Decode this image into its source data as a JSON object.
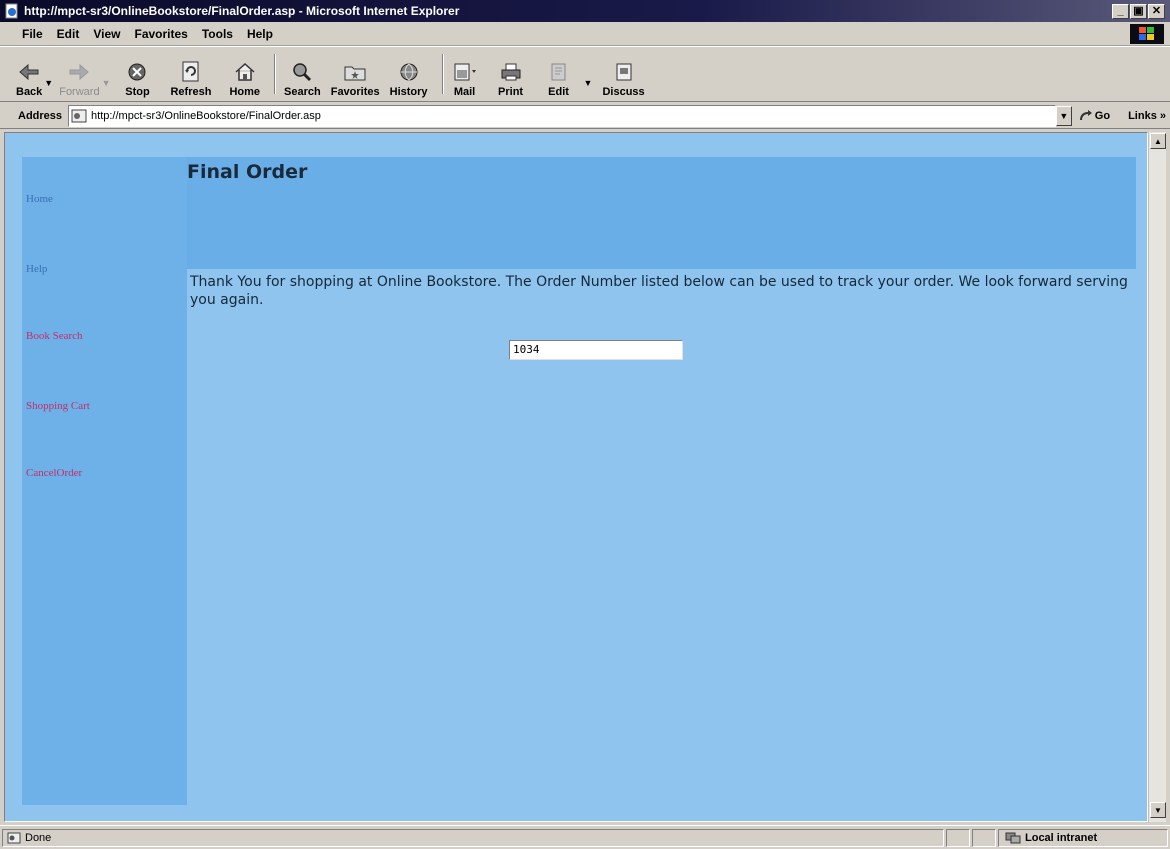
{
  "window": {
    "title": "http://mpct-sr3/OnlineBookstore/FinalOrder.asp - Microsoft Internet Explorer"
  },
  "menu": [
    "File",
    "Edit",
    "View",
    "Favorites",
    "Tools",
    "Help"
  ],
  "toolbar": {
    "back": "Back",
    "forward": "Forward",
    "stop": "Stop",
    "refresh": "Refresh",
    "home": "Home",
    "search": "Search",
    "favorites": "Favorites",
    "history": "History",
    "mail": "Mail",
    "print": "Print",
    "edit": "Edit",
    "discuss": "Discuss"
  },
  "address": {
    "label": "Address",
    "url": "http://mpct-sr3/OnlineBookstore/FinalOrder.asp",
    "go": "Go",
    "links": "Links"
  },
  "page": {
    "title": "Final Order",
    "nav": [
      {
        "label": "Home",
        "color": "#3a6fb0"
      },
      {
        "label": "Help",
        "color": "#3a6fb0"
      },
      {
        "label": "Book Search",
        "color": "#c0306a"
      },
      {
        "label": "Shopping Cart",
        "color": "#c0306a"
      },
      {
        "label": "CancelOrder",
        "color": "#c0306a"
      }
    ],
    "message": "Thank You for shopping at Online Bookstore. The Order Number listed below can be used to track your order. We look forward serving you again.",
    "order_number": "1034"
  },
  "status": {
    "text": "Done",
    "zone": "Local intranet"
  }
}
